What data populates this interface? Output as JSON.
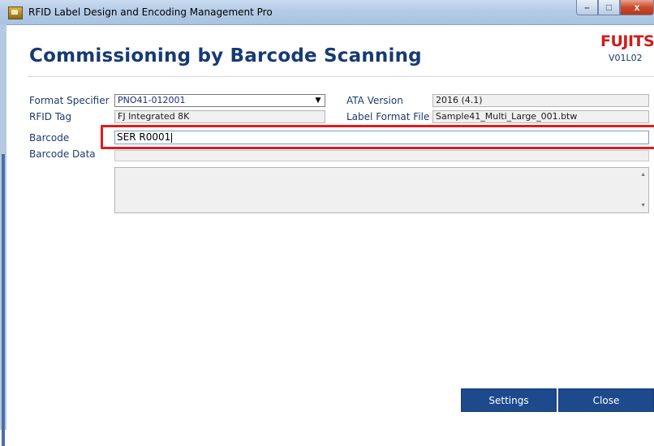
{
  "window": {
    "title": "RFID Label Design and Encoding Management Pro",
    "controls": {
      "minimize": "–",
      "maximize": "□",
      "close": "x"
    }
  },
  "header": {
    "title": "Commissioning by Barcode Scanning",
    "brand": "FUJITSU",
    "version": "V01L02"
  },
  "form": {
    "format_specifier": {
      "label": "Format Specifier",
      "value": "PNO41-012001"
    },
    "ata_version": {
      "label": "ATA Version",
      "value": "2016 (4.1)"
    },
    "rfid_tag": {
      "label": "RFID Tag",
      "value": "FJ Integrated 8K"
    },
    "label_format_file": {
      "label": "Label Format File",
      "value": "Sample41_Multi_Large_001.btw"
    },
    "barcode": {
      "label": "Barcode",
      "value": "SER R0001"
    },
    "barcode_data": {
      "label": "Barcode Data",
      "value": ""
    }
  },
  "buttons": {
    "settings": "Settings",
    "close": "Close"
  },
  "colors": {
    "accent": "#163a73",
    "button": "#1d4a8c",
    "highlight": "#e31a1a",
    "brand": "#d11b1b"
  }
}
